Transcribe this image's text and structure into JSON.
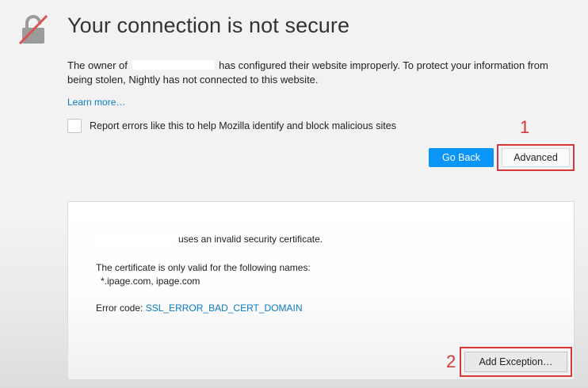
{
  "header": {
    "title": "Your connection is not secure",
    "icon": "broken-lock-icon"
  },
  "description": {
    "prefix": "The owner of",
    "suffix": "has configured their website improperly. To protect your information from being stolen, Nightly has not connected to this website."
  },
  "learn_more": "Learn more…",
  "report": {
    "label": "Report errors like this to help Mozilla identify and block malicious sites",
    "checked": false
  },
  "buttons": {
    "go_back": "Go Back",
    "advanced": "Advanced",
    "add_exception": "Add Exception…"
  },
  "annotations": {
    "step1": "1",
    "step2": "2"
  },
  "advanced_panel": {
    "invalid_cert": "uses an invalid security certificate.",
    "valid_names_label": "The certificate is only valid for the following names:",
    "valid_names": "*.ipage.com, ipage.com",
    "error_code_label": "Error code:",
    "error_code": "SSL_ERROR_BAD_CERT_DOMAIN"
  },
  "colors": {
    "primary_button": "#0996f8",
    "link": "#0a7bc2",
    "annotation_red": "#d43838",
    "lock_gray": "#9b9b9b"
  }
}
